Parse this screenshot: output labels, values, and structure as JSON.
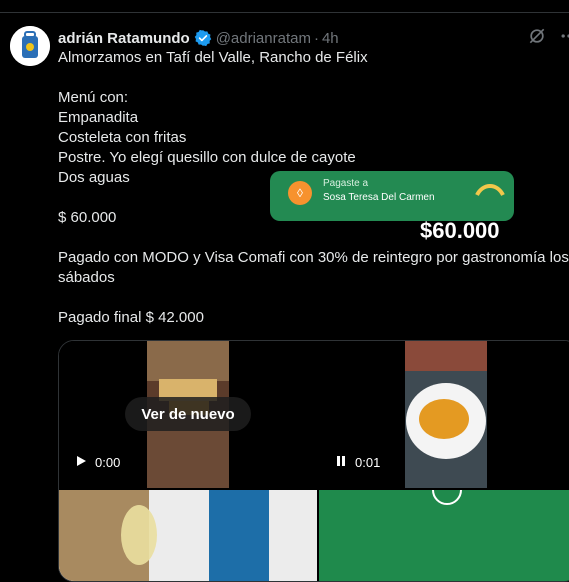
{
  "tweet": {
    "author_name": "adrián Ratamundo",
    "handle": "@adrianratam",
    "separator": "·",
    "time": "4h",
    "text": "Almorzamos en Tafí del Valle, Rancho de Félix\n\nMenú con:\nEmpanadita\nCosteleta con fritas\nPostre. Yo elegí quesillo con dulce de cayote\nDos aguas\n\n$ 60.000\n\nPagado con MODO y Visa Comafi con 30% de reintegro por gastronomía los sábados\n\nPagado final $ 42.000"
  },
  "media": {
    "replay_label": "Ver de nuevo",
    "video_1_time": "0:00",
    "video_2_time": "0:01",
    "modo_sub": "Pagaste a",
    "modo_name": "Sosa Teresa Del Carmen",
    "amount_peek": "$60.000"
  },
  "colors": {
    "background": "#000000",
    "text": "#e7e9ea",
    "muted": "#71767b",
    "verified": "#1d9bf0",
    "modo_green": "#238a52"
  },
  "icons": [
    "verified-badge-icon",
    "grok-icon",
    "more-icon",
    "play-icon",
    "pause-icon"
  ]
}
